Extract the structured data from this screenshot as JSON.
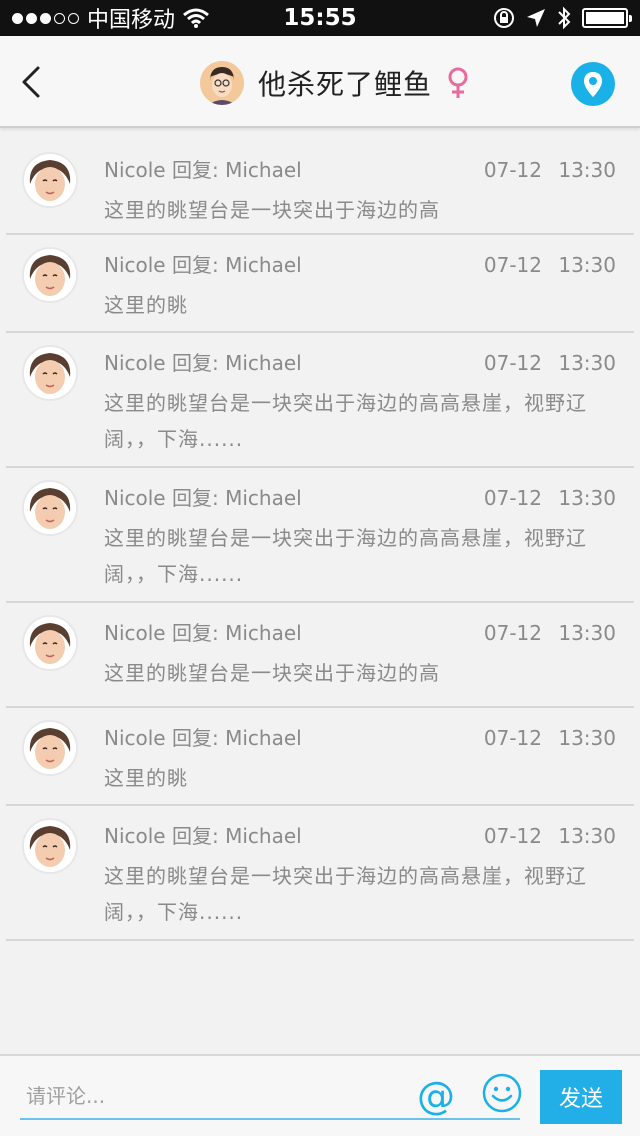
{
  "status_bar": {
    "carrier": "中国移动",
    "time": "15:55"
  },
  "nav": {
    "title": "他杀死了鲤鱼",
    "avatar_icon": "cartoon-avatar-icon",
    "back_icon": "chevron-left-icon",
    "gender_icon": "female-symbol-icon",
    "location_icon": "map-pin-icon",
    "accent_color": "#1ab0e8",
    "gender_color": "#e76b9d"
  },
  "comments": [
    {
      "author": "Nicole",
      "reply_word": "回复:",
      "target": "Michael",
      "date": "07-12",
      "time": "13:30",
      "text": "这里的眺望台是一块突出于海边的高"
    },
    {
      "author": "Nicole",
      "reply_word": "回复:",
      "target": "Michael",
      "date": "07-12",
      "time": "13:30",
      "text": "这里的眺"
    },
    {
      "author": "Nicole",
      "reply_word": "回复:",
      "target": "Michael",
      "date": "07-12",
      "time": "13:30",
      "text": "这里的眺望台是一块突出于海边的高高悬崖，视野辽阔，，下海......"
    },
    {
      "author": "Nicole",
      "reply_word": "回复:",
      "target": "Michael",
      "date": "07-12",
      "time": "13:30",
      "text": "这里的眺望台是一块突出于海边的高高悬崖，视野辽阔，，下海......"
    },
    {
      "author": "Nicole",
      "reply_word": "回复:",
      "target": "Michael",
      "date": "07-12",
      "time": "13:30",
      "text": "这里的眺望台是一块突出于海边的高"
    },
    {
      "author": "Nicole",
      "reply_word": "回复:",
      "target": "Michael",
      "date": "07-12",
      "time": "13:30",
      "text": "这里的眺"
    },
    {
      "author": "Nicole",
      "reply_word": "回复:",
      "target": "Michael",
      "date": "07-12",
      "time": "13:30",
      "text": "这里的眺望台是一块突出于海边的高高悬崖，视野辽阔，，下海......"
    }
  ],
  "input_bar": {
    "placeholder": "请评论...",
    "at_symbol": "@",
    "send_label": "发送",
    "emoji_icon": "smiley-icon"
  }
}
